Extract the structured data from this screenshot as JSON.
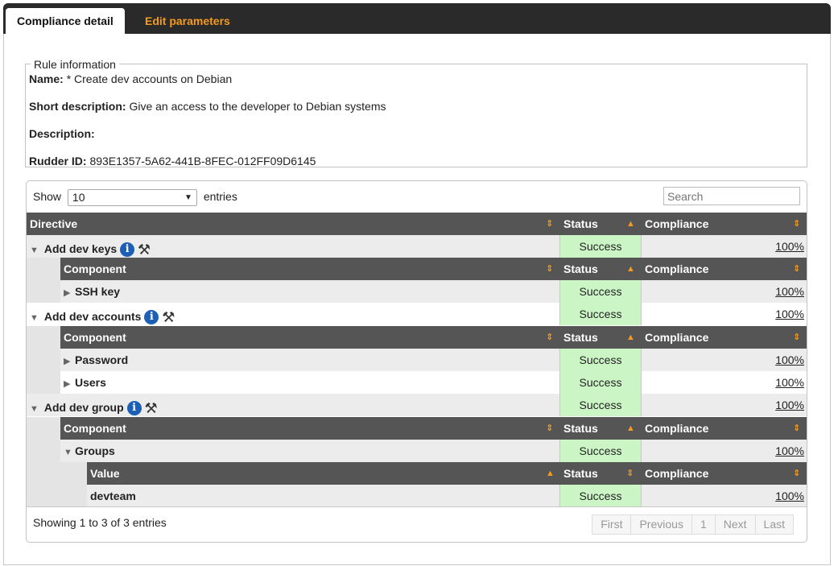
{
  "tabs": [
    {
      "label": "Compliance detail"
    },
    {
      "label": "Edit parameters"
    }
  ],
  "rule": {
    "legend": "Rule information",
    "name_label": "Name:",
    "name_value": "* Create dev accounts on Debian",
    "short_label": "Short description:",
    "short_value": "Give an access to the developer to Debian systems",
    "desc_label": "Description:",
    "desc_value": "",
    "id_label": "Rudder ID:",
    "id_value": "893E1357-5A62-441B-8FEC-012FF09D6145"
  },
  "table": {
    "show_label": "Show",
    "show_value": "10",
    "entries_label": "entries",
    "search_placeholder": "Search",
    "headers": {
      "directive": "Directive",
      "component": "Component",
      "value": "Value",
      "status": "Status",
      "compliance": "Compliance"
    },
    "footer": "Showing 1 to 3 of 3 entries",
    "pager": {
      "first": "First",
      "previous": "Previous",
      "page": "1",
      "next": "Next",
      "last": "Last"
    }
  },
  "rows": {
    "dir1": {
      "name": "Add dev keys",
      "status": "Success",
      "compliance": "100%"
    },
    "dir1_c1": {
      "name": "SSH key",
      "status": "Success",
      "compliance": "100%"
    },
    "dir2": {
      "name": "Add dev accounts",
      "status": "Success",
      "compliance": "100%"
    },
    "dir2_c1": {
      "name": "Password",
      "status": "Success",
      "compliance": "100%"
    },
    "dir2_c2": {
      "name": "Users",
      "status": "Success",
      "compliance": "100%"
    },
    "dir3": {
      "name": "Add dev group",
      "status": "Success",
      "compliance": "100%"
    },
    "dir3_c1": {
      "name": "Groups",
      "status": "Success",
      "compliance": "100%"
    },
    "dir3_c1_v1": {
      "name": "devteam",
      "status": "Success",
      "compliance": "100%"
    }
  },
  "icons": {
    "expanded": "triangle-down",
    "collapsed": "triangle-right",
    "info": "info-icon",
    "tools": "tools-icon"
  },
  "colors": {
    "accent": "#f49b1f",
    "success_bg": "#ccf5c6",
    "header_bg": "#555555",
    "tabbar_bg": "#2a2a2a"
  }
}
